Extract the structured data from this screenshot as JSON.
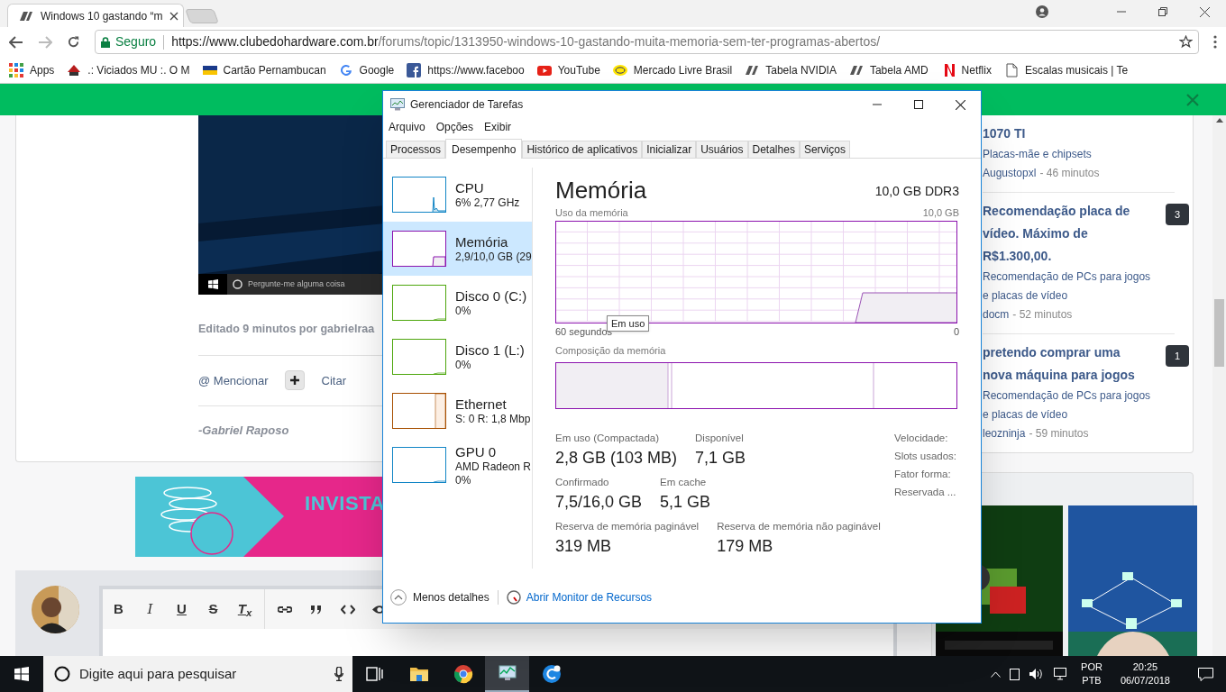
{
  "browser": {
    "tabs": [
      {
        "title": "Windows 10 gastando “m",
        "selected": true
      }
    ],
    "address": {
      "secure_label": "Seguro",
      "url_host": "https://www.clubedohardware.com.br",
      "url_path": "/forums/topic/1313950-windows-10-gastando-muita-memoria-sem-ter-programas-abertos/"
    },
    "bookmarks": [
      "Apps",
      ".: Viciados MU :. O M",
      "Cartão Pernambucan",
      "Google",
      "https://www.faceboo",
      "YouTube",
      "Mercado Livre Brasil",
      "Tabela NVIDIA",
      "Tabela AMD",
      "Netflix",
      "Escalas musicais | Te"
    ]
  },
  "post": {
    "image_caption": "Pergunte-me alguma coisa",
    "edited": "Editado 9 minutos por gabrielraa",
    "mention": "@ Mencionar",
    "quote": "Citar",
    "signature": "-Gabriel Raposo"
  },
  "ad": {
    "headline": "INVISTA"
  },
  "editor": {
    "buttons": [
      {
        "kind": "bold",
        "label": "B"
      },
      {
        "kind": "italic",
        "label": "I"
      },
      {
        "kind": "underline",
        "label": "U"
      },
      {
        "kind": "strike",
        "label": "S"
      },
      {
        "kind": "clear",
        "label": "T$_{x}$"
      }
    ]
  },
  "sidebar": {
    "topics": [
      {
        "title": "1070 TI",
        "forum": "Placas-mãe e chipsets",
        "author": "Augustopxl",
        "time": "- 46 minutos"
      },
      {
        "title": "Recomendação placa de vídeo. Máximo de R$1.300,00.",
        "forum": "Recomendação de PCs para jogos e placas de vídeo",
        "author": "docm",
        "time": "- 52 minutos",
        "replies": "3"
      },
      {
        "title": "pretendo comprar uma nova máquina para jogos",
        "forum": "Recomendação de PCs para jogos e placas de vídeo",
        "author": "leozninja",
        "time": "- 59 minutos",
        "replies": "1"
      }
    ]
  },
  "task_manager": {
    "title": "Gerenciador de Tarefas",
    "menu": [
      "Arquivo",
      "Opções",
      "Exibir"
    ],
    "tabs": [
      {
        "label": "Processos",
        "selected": false
      },
      {
        "label": "Desempenho",
        "selected": true
      },
      {
        "label": "Histórico de aplicativos",
        "selected": false
      },
      {
        "label": "Inicializar",
        "selected": false
      },
      {
        "label": "Usuários",
        "selected": false
      },
      {
        "label": "Detalhes",
        "selected": false
      },
      {
        "label": "Serviços",
        "selected": false
      }
    ],
    "resources": [
      {
        "name": "CPU",
        "lines": [
          "6%  2,77 GHz"
        ],
        "color": "#1185c5",
        "selected": false
      },
      {
        "name": "Memória",
        "lines": [
          "2,9/10,0 GB (29"
        ],
        "color": "#8b12ae",
        "selected": true
      },
      {
        "name": "Disco 0 (C:)",
        "lines": [
          "0%"
        ],
        "color": "#4da60c",
        "selected": false
      },
      {
        "name": "Disco 1 (L:)",
        "lines": [
          "0%"
        ],
        "color": "#4da60c",
        "selected": false
      },
      {
        "name": "Ethernet",
        "lines": [
          "S: 0 R: 1,8 Mbp"
        ],
        "color": "#a74f01",
        "selected": false
      },
      {
        "name": "GPU 0",
        "lines": [
          "AMD Radeon R",
          "0%"
        ],
        "color": "#1185c5",
        "selected": false
      }
    ],
    "detail": {
      "title": "Memória",
      "spec": "10,0 GB DDR3",
      "usage_label": "Uso da memória",
      "usage_max": "10,0 GB",
      "axis_start": "60 segundos",
      "axis_end": "0",
      "tooltip": "Em uso",
      "composition_label": "Composição da memória",
      "stats": [
        [
          {
            "label": "Em uso (Compactada)",
            "value": "2,8 GB (103 MB)"
          },
          {
            "label": "Disponível",
            "value": "7,1 GB"
          }
        ],
        [
          {
            "label": "Confirmado",
            "value": "7,5/16,0 GB"
          },
          {
            "label": "Em cache",
            "value": "5,1 GB"
          }
        ],
        [
          {
            "label": "Reserva de memória paginável",
            "value": "319 MB"
          },
          {
            "label": "Reserva de memória não paginável",
            "value": "179 MB"
          }
        ]
      ],
      "side_labels": [
        "Velocidade:",
        "Slots usados:",
        "Fator forma:",
        "Reservada ..."
      ]
    },
    "footer": {
      "less": "Menos detalhes",
      "link": "Abrir Monitor de Recursos"
    }
  },
  "taskbar": {
    "search_placeholder": "Digite aqui para pesquisar",
    "language": "POR",
    "layout": "PTB",
    "time": "20:25",
    "date": "06/07/2018"
  }
}
